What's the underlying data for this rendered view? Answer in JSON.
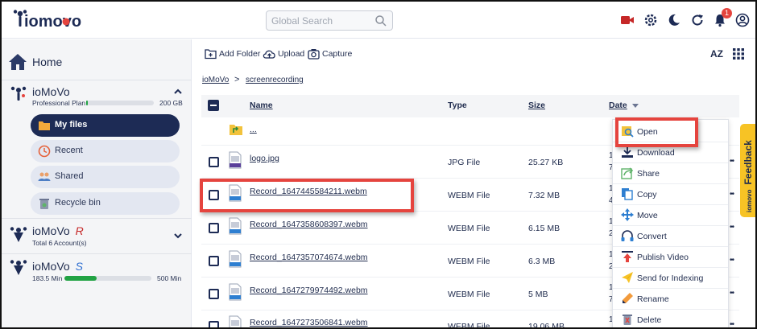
{
  "header": {
    "logo_text": "iomovo",
    "search_placeholder": "Global Search",
    "notification_count": "1"
  },
  "sidebar": {
    "home_label": "Home",
    "account_main": {
      "name": "ioMoVo",
      "plan": "Professional Plan",
      "storage": "200 GB",
      "storage_used_fraction": 0.02
    },
    "nav_items": [
      {
        "label": "My files",
        "active": true
      },
      {
        "label": "Recent",
        "active": false
      },
      {
        "label": "Shared",
        "active": false
      },
      {
        "label": "Recycle bin",
        "active": false
      }
    ],
    "account_r": {
      "name": "ioMoVo",
      "suffix": "R",
      "sub": "Total 6 Account(s)"
    },
    "account_s": {
      "name": "ioMoVo",
      "suffix": "S",
      "used": "183.5 Min",
      "total": "500 Min",
      "used_fraction": 0.367
    }
  },
  "toolbar": {
    "add_folder": "Add Folder",
    "upload": "Upload",
    "capture": "Capture",
    "sort_label": "AZ"
  },
  "breadcrumb": [
    "ioMoVo",
    "screenrecording"
  ],
  "breadcrumb_sep": ">",
  "table": {
    "columns": [
      "Name",
      "Type",
      "Size",
      "Date"
    ],
    "parent_row": "...",
    "rows": [
      {
        "name": "logo.jpg",
        "type": "JPG File",
        "size": "25.27 KB",
        "icon": "IMG",
        "date_top": "1",
        "date_bot": "7"
      },
      {
        "name": "Record_1647445584211.webm",
        "type": "WEBM File",
        "size": "7.32 MB",
        "icon": "VID",
        "date_top": "1",
        "date_bot": "4"
      },
      {
        "name": "Record_1647358608397.webm",
        "type": "WEBM File",
        "size": "6.15 MB",
        "icon": "VID",
        "date_top": "1",
        "date_bot": "2"
      },
      {
        "name": "Record_1647357074674.webm",
        "type": "WEBM File",
        "size": "6.3 MB",
        "icon": "VID",
        "date_top": "1",
        "date_bot": "2"
      },
      {
        "name": "Record_1647279974492.webm",
        "type": "WEBM File",
        "size": "5 MB",
        "icon": "VID",
        "date_top": "1",
        "date_bot": "7"
      },
      {
        "name": "Record_1647273506841.webm",
        "type": "WEBM File",
        "size": "19.06 MB",
        "icon": "VID",
        "date_top": "1",
        "date_bot": ""
      }
    ]
  },
  "context_menu": [
    {
      "label": "Open",
      "icon": "open-icon"
    },
    {
      "label": "Download",
      "icon": "download-icon"
    },
    {
      "label": "Share",
      "icon": "share-icon"
    },
    {
      "label": "Copy",
      "icon": "copy-icon"
    },
    {
      "label": "Move",
      "icon": "move-icon"
    },
    {
      "label": "Convert",
      "icon": "convert-icon"
    },
    {
      "label": "Publish Video",
      "icon": "publish-icon"
    },
    {
      "label": "Send for Indexing",
      "icon": "send-icon"
    },
    {
      "label": "Rename",
      "icon": "rename-icon"
    },
    {
      "label": "Delete",
      "icon": "delete-icon"
    }
  ],
  "feedback_label": "Feedback",
  "feedback_brand": "iomovo",
  "colors": {
    "navy": "#1d2b55",
    "highlight_red": "#e5443e",
    "feedback_yellow": "#f7c325",
    "progress_green": "#22a344"
  }
}
